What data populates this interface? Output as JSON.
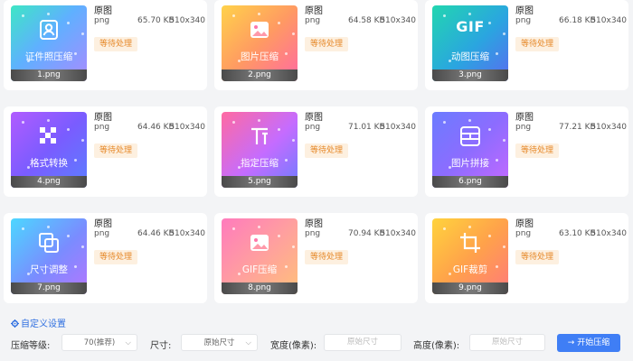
{
  "cards": [
    {
      "title_label": "原图",
      "format": "png",
      "size": "65.70 KB",
      "dimensions": "510x340",
      "status": "等待处理",
      "thumb_title": "证件照压缩",
      "filename": "1.png",
      "icon": "portrait-icon",
      "gradient": "g1"
    },
    {
      "title_label": "原图",
      "format": "png",
      "size": "64.58 KB",
      "dimensions": "510x340",
      "status": "等待处理",
      "thumb_title": "图片压缩",
      "filename": "2.png",
      "icon": "image-icon",
      "gradient": "g2"
    },
    {
      "title_label": "原图",
      "format": "png",
      "size": "66.18 KB",
      "dimensions": "510x340",
      "status": "等待处理",
      "thumb_title": "动图压缩",
      "thumb_glyph": "GIF",
      "filename": "3.png",
      "icon": "gif-icon",
      "gradient": "g3"
    },
    {
      "title_label": "原图",
      "format": "png",
      "size": "64.46 KB",
      "dimensions": "510x340",
      "status": "等待处理",
      "thumb_title": "格式转换",
      "filename": "4.png",
      "icon": "checker-icon",
      "gradient": "g4"
    },
    {
      "title_label": "原图",
      "format": "png",
      "size": "71.01 KB",
      "dimensions": "510x340",
      "status": "等待处理",
      "thumb_title": "指定压缩",
      "filename": "5.png",
      "icon": "text-t-icon",
      "gradient": "g5"
    },
    {
      "title_label": "原图",
      "format": "png",
      "size": "77.21 KB",
      "dimensions": "510x340",
      "status": "等待处理",
      "thumb_title": "图片拼接",
      "filename": "6.png",
      "icon": "collage-icon",
      "gradient": "g6"
    },
    {
      "title_label": "原图",
      "format": "png",
      "size": "64.46 KB",
      "dimensions": "510x340",
      "status": "等待处理",
      "thumb_title": "尺寸调整",
      "filename": "7.png",
      "icon": "resize-icon",
      "gradient": "g7"
    },
    {
      "title_label": "原图",
      "format": "png",
      "size": "70.94 KB",
      "dimensions": "510x340",
      "status": "等待处理",
      "thumb_title": "GIF压缩",
      "filename": "8.png",
      "icon": "image-icon",
      "gradient": "g8"
    },
    {
      "title_label": "原图",
      "format": "png",
      "size": "63.10 KB",
      "dimensions": "510x340",
      "status": "等待处理",
      "thumb_title": "GIF裁剪",
      "filename": "9.png",
      "icon": "crop-icon",
      "gradient": "g9"
    }
  ],
  "settings": {
    "custom_label": "自定义设置",
    "level_label": "压缩等级:",
    "level_value": "70(推荐)",
    "size_label": "尺寸:",
    "size_value": "原始尺寸",
    "width_label": "宽度(像素):",
    "width_placeholder": "原始尺寸",
    "height_label": "高度(像素):",
    "height_placeholder": "原始尺寸",
    "start_label": "开始压缩"
  },
  "colors": {
    "accent": "#3f7ef5",
    "status": "#e6892a",
    "status_bg": "#fdf0e0"
  }
}
